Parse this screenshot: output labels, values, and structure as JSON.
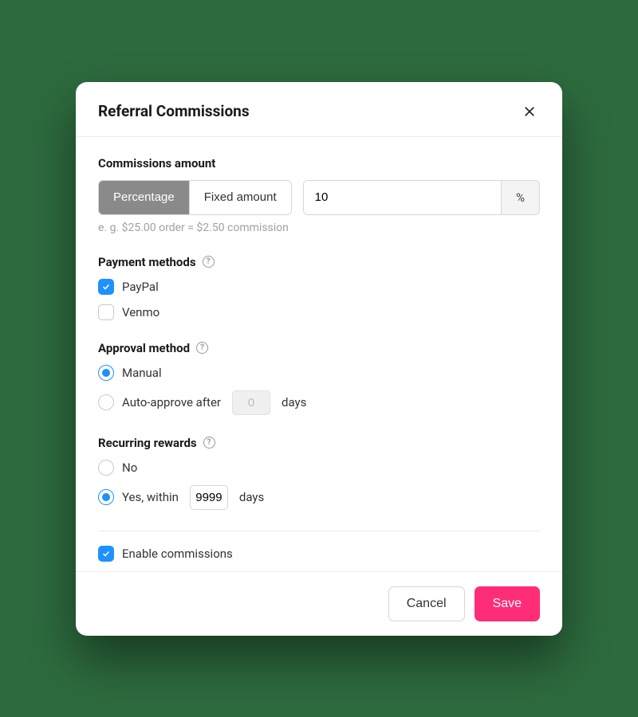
{
  "modal": {
    "title": "Referral Commissions"
  },
  "commissions": {
    "label": "Commissions amount",
    "tabs": {
      "percentage": "Percentage",
      "fixed": "Fixed amount"
    },
    "value": "10",
    "unit": "%",
    "hint": "e. g. $25.00 order = $2.50 commission"
  },
  "payment": {
    "label": "Payment methods",
    "options": {
      "paypal": "PayPal",
      "venmo": "Venmo"
    }
  },
  "approval": {
    "label": "Approval method",
    "manual": "Manual",
    "auto_prefix": "Auto-approve after",
    "auto_value": "0",
    "auto_suffix": "days"
  },
  "recurring": {
    "label": "Recurring rewards",
    "no": "No",
    "yes_prefix": "Yes, within",
    "yes_value": "9999",
    "yes_suffix": "days"
  },
  "enable": {
    "label": "Enable commissions"
  },
  "footer": {
    "cancel": "Cancel",
    "save": "Save"
  }
}
